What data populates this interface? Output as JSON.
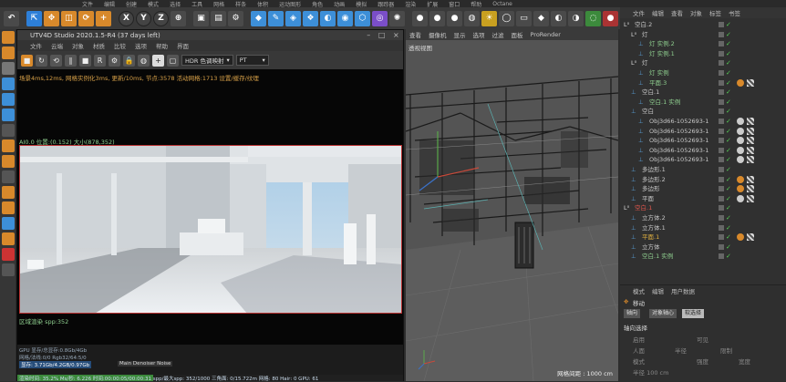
{
  "menubar": [
    "文件",
    "编辑",
    "创建",
    "模式",
    "选择",
    "工具",
    "网格",
    "样条",
    "体积",
    "运动图形",
    "角色",
    "动画",
    "模拟",
    "跟踪器",
    "渲染",
    "扩展",
    "窗口",
    "帮助",
    "Octane"
  ],
  "toolbar": {
    "axis_x": "X",
    "axis_y": "Y",
    "axis_z": "Z"
  },
  "octane": {
    "title": "UTV4D Studio 2020.1.5-R4 (37 days left)",
    "menu": [
      "文件",
      "云端",
      "对象",
      "材质",
      "比较",
      "选项",
      "帮助",
      "界面"
    ],
    "hdr_select": "HDR 色调映射",
    "pt_select": "PT",
    "stats": "场景4ms,12ms, 网格实例化3ms, 更新/10ms, 节点:3578 活动网格:1713 设置/缓存/纹理",
    "info": "AI0.0 位置:(0.152) 大小(878,352)",
    "spp": "区域渲染 spp:352",
    "bottom": {
      "line1": "GPU 显存/总显存:0.8Gb/4Gb",
      "line2": "网格/法线:0/0     Rgb32/64:5/0",
      "line3": "显存: 3.71Gb/4.2GB/0.97Gb",
      "noise": "Main Denoiser Noise",
      "progress": "渲染时间: 35.2%  Ms/秒: 6.226  时间:00:00:05/00:00:31  spp/最大spp: 352/1000  三角面: 0/15.722m  网格: 80  Hair: 0  GPU: 61",
      "progress_pct": 35.2
    }
  },
  "viewport": {
    "menu": [
      "查看",
      "摄像机",
      "显示",
      "选项",
      "过滤",
      "面板",
      "ProRender"
    ],
    "label": "透视视图",
    "grid": "网格间距 : 1000 cm"
  },
  "objects": {
    "tabs": [
      "文件",
      "编辑",
      "查看",
      "对象",
      "标签",
      "书签"
    ],
    "rows": [
      {
        "depth": 0,
        "name": "空白.2",
        "color": "#c8c8c8",
        "layer": true
      },
      {
        "depth": 1,
        "name": "灯",
        "color": "#c8c8c8",
        "layer": true
      },
      {
        "depth": 2,
        "name": "灯 实例.2",
        "color": "#8fcf8f"
      },
      {
        "depth": 2,
        "name": "灯 实例.1",
        "color": "#8fcf8f"
      },
      {
        "depth": 1,
        "name": "灯",
        "color": "#c8c8c8",
        "layer": true
      },
      {
        "depth": 2,
        "name": "灯 实例",
        "color": "#8fcf8f"
      },
      {
        "depth": 2,
        "name": "平面.3",
        "color": "#8fcf8f",
        "tag": "#d8892b"
      },
      {
        "depth": 1,
        "name": "空白.1",
        "color": "#c8c8c8"
      },
      {
        "depth": 2,
        "name": "空白.1 实例",
        "color": "#8fcf8f"
      },
      {
        "depth": 1,
        "name": "空白",
        "color": "#c8c8c8"
      },
      {
        "depth": 2,
        "name": "Obj3d66-1052693-1",
        "color": "#c8c8c8",
        "tag": "#cccccc"
      },
      {
        "depth": 2,
        "name": "Obj3d66-1052693-1",
        "color": "#c8c8c8",
        "tag": "#cccccc"
      },
      {
        "depth": 2,
        "name": "Obj3d66-1052693-1",
        "color": "#c8c8c8",
        "tag": "#cccccc"
      },
      {
        "depth": 2,
        "name": "Obj3d66-1052693-1",
        "color": "#c8c8c8",
        "tag": "#cccccc"
      },
      {
        "depth": 2,
        "name": "Obj3d66-1052693-1",
        "color": "#c8c8c8",
        "tag": "#cccccc"
      },
      {
        "depth": 1,
        "name": "多边形.1",
        "color": "#c8c8c8"
      },
      {
        "depth": 1,
        "name": "多边形.2",
        "color": "#c8c8c8",
        "tag": "#d8892b"
      },
      {
        "depth": 1,
        "name": "多边形",
        "color": "#c8c8c8",
        "tag": "#d8892b"
      },
      {
        "depth": 1,
        "name": "平面",
        "color": "#c8c8c8",
        "tag": "#cccccc"
      },
      {
        "depth": 0,
        "name": "空白.1",
        "color": "#e2564c",
        "layer": true
      },
      {
        "depth": 1,
        "name": "立方体.2",
        "color": "#c8c8c8"
      },
      {
        "depth": 1,
        "name": "立方体.1",
        "color": "#c8c8c8"
      },
      {
        "depth": 1,
        "name": "平面.1",
        "color": "#e0b040",
        "tag": "#d8892b"
      },
      {
        "depth": 1,
        "name": "立方体",
        "color": "#c8c8c8"
      },
      {
        "depth": 1,
        "name": "空白.1 实例",
        "color": "#8fcf8f"
      }
    ]
  },
  "attributes": {
    "tabs": [
      "模式",
      "编辑",
      "用户数据"
    ],
    "tool": "移动",
    "buttons": [
      "轴向",
      "对象轴心",
      "软选择"
    ],
    "section": "轴向选择",
    "fields": [
      "启用",
      "可见",
      "人面",
      "半径",
      "模式",
      "强度",
      "限制",
      "宽度",
      "半径 100 cm"
    ]
  }
}
